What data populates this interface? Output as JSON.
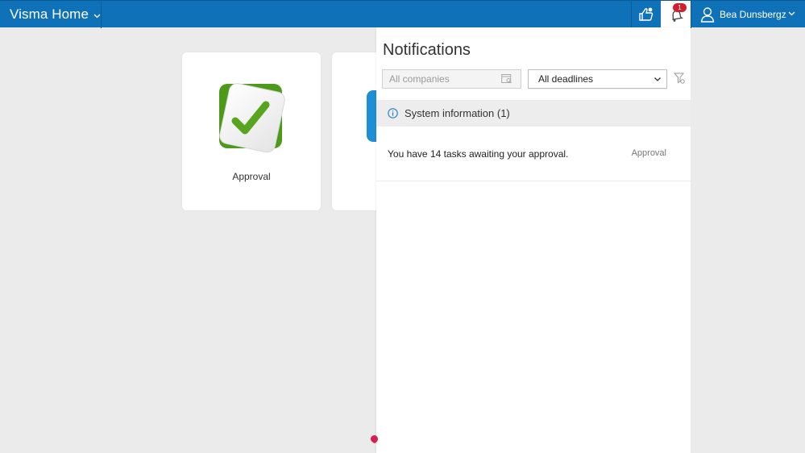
{
  "header": {
    "app_title": "Visma Home",
    "user_name": "Bea Dunsbergz",
    "notification_count": "1"
  },
  "tiles": [
    {
      "label": "Approval"
    }
  ],
  "notifications": {
    "title": "Notifications",
    "company_filter": {
      "placeholder": "All companies",
      "value": ""
    },
    "deadline_filter": {
      "selected": "All deadlines"
    },
    "sections": [
      {
        "title": "System information (1)",
        "items": [
          {
            "text": "You have 14 tasks awaiting your approval.",
            "category": "Approval"
          }
        ]
      }
    ]
  },
  "colors": {
    "header_bg": "#0f72b8",
    "badge": "#d01f2e",
    "approval_green": "#4d9a1b"
  }
}
